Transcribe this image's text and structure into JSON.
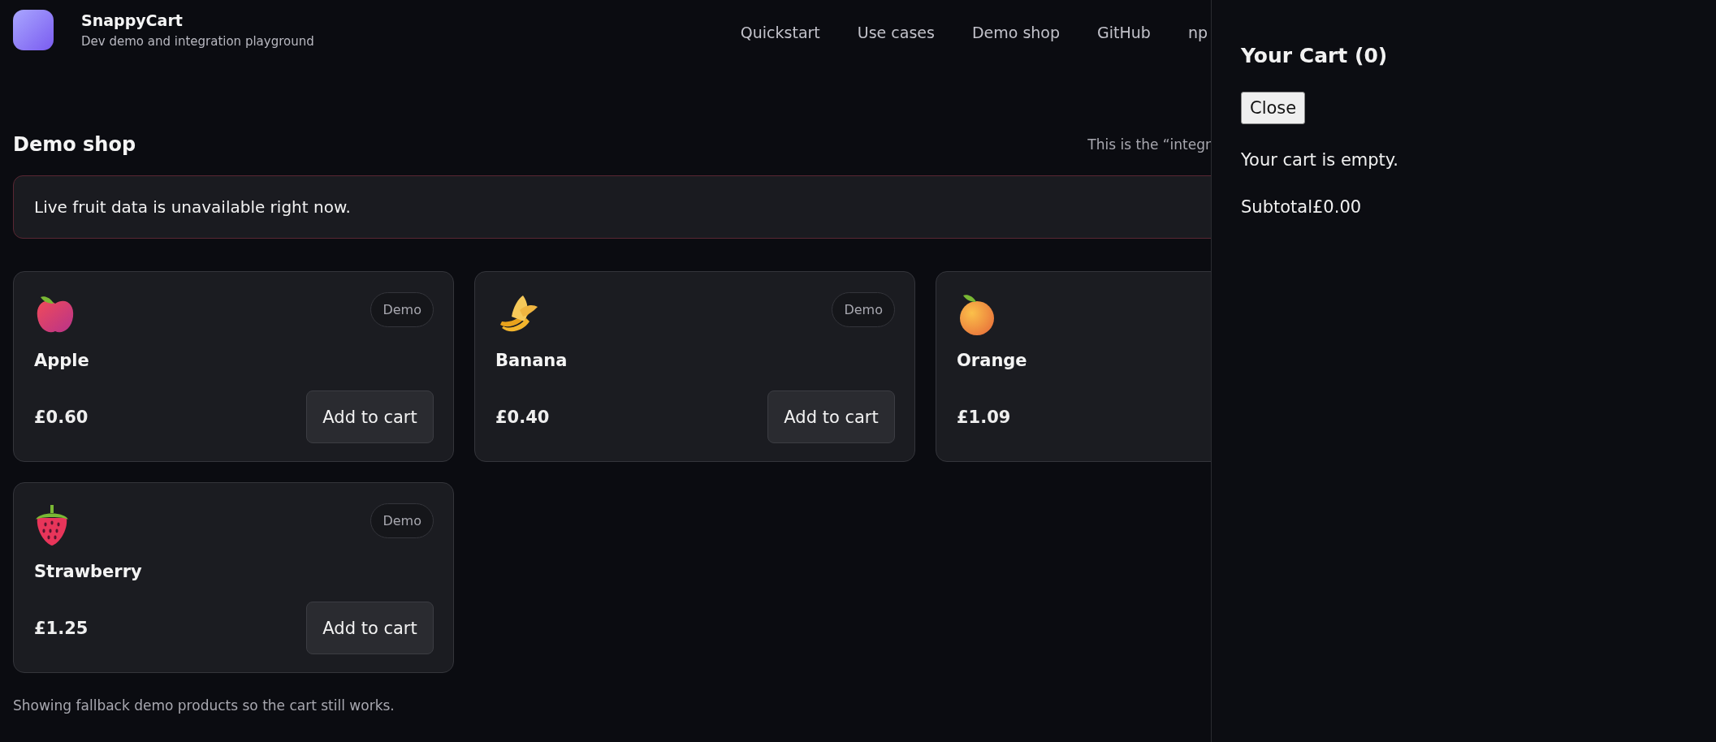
{
  "brand": {
    "title": "SnappyCart",
    "subtitle": "Dev demo and integration playground"
  },
  "nav": [
    "Quickstart",
    "Use cases",
    "Demo shop",
    "GitHub",
    "np"
  ],
  "shop": {
    "title": "Demo shop",
    "note": "This is the “integr",
    "alert": "Live fruit data is unavailable right now.",
    "products": [
      {
        "kind": "apple",
        "badge": "Demo",
        "name": "Apple",
        "price": "£0.60",
        "button": "Add to cart"
      },
      {
        "kind": "banana",
        "badge": "Demo",
        "name": "Banana",
        "price": "£0.40",
        "button": "Add to cart"
      },
      {
        "kind": "orange",
        "name": "Orange",
        "price": "£1.09"
      },
      {
        "kind": "strawberry",
        "badge": "Demo",
        "name": "Strawberry",
        "price": "£1.25",
        "button": "Add to cart"
      }
    ],
    "footnote": "Showing fallback demo products so the cart still works."
  },
  "cart": {
    "title": "Your Cart (0)",
    "close": "Close",
    "empty": "Your cart is empty.",
    "subtotal_label": "Subtotal",
    "subtotal": "£0.00"
  }
}
